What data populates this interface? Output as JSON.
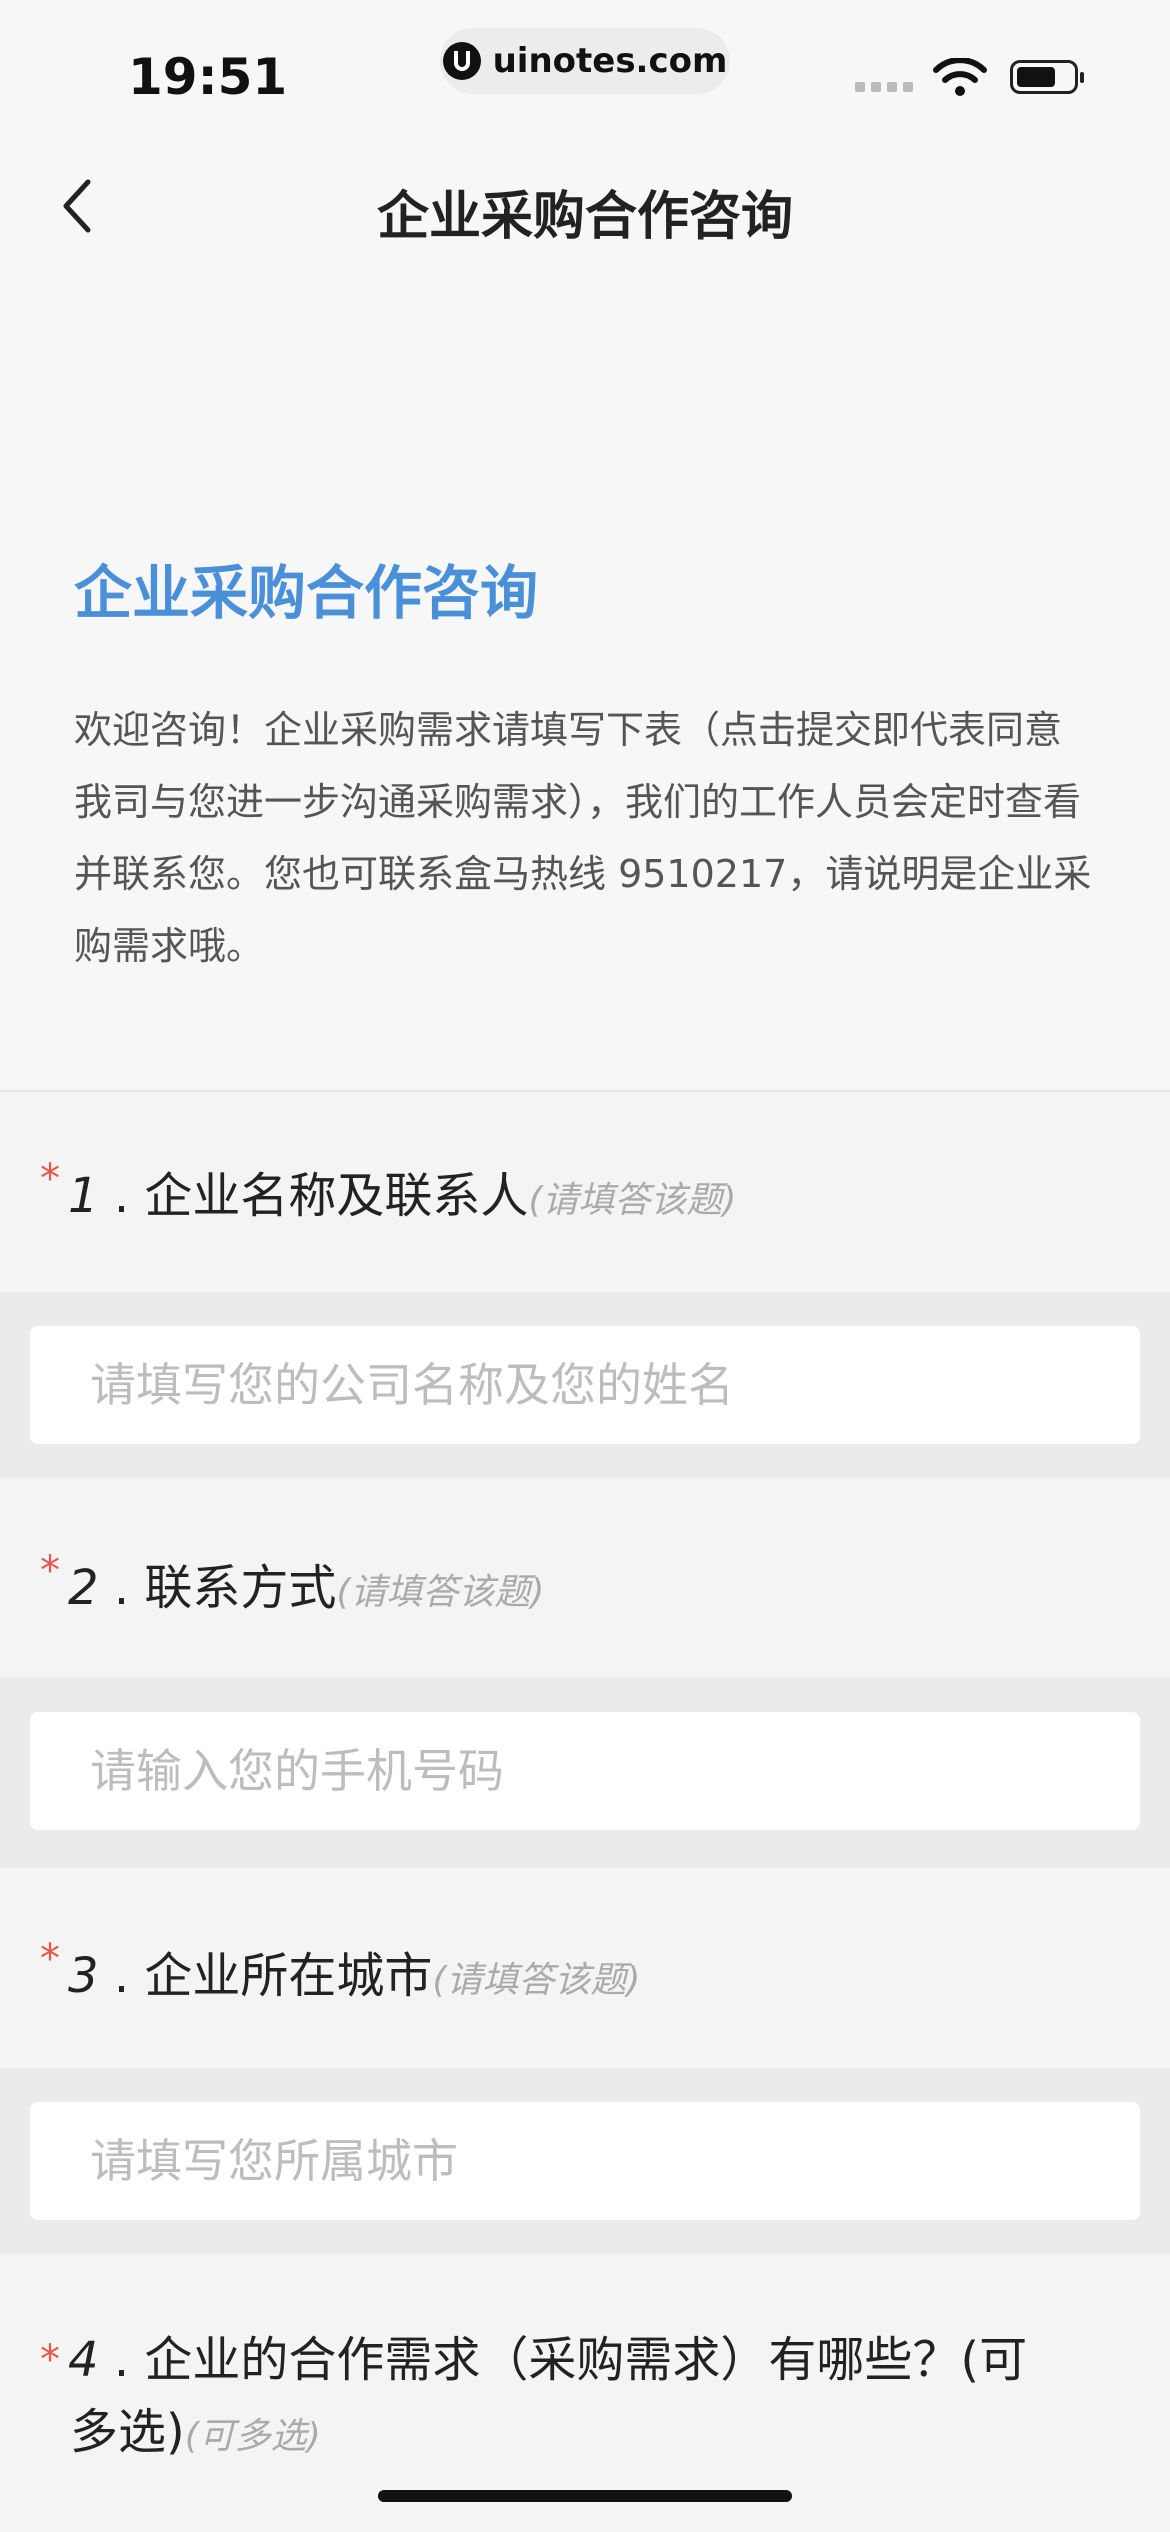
{
  "status_bar": {
    "time": "19:51",
    "url": "uinotes.com"
  },
  "nav": {
    "title": "企业采购合作咨询",
    "back_icon": "chevron-left-icon"
  },
  "intro": {
    "heading": "企业采购合作咨询",
    "text": "欢迎咨询！企业采购需求请填写下表（点击提交即代表同意我司与您进一步沟通采购需求），我们的工作人员会定时查看并联系您。您也可联系盒马热线 9510217，请说明是企业采购需求哦。"
  },
  "questions": [
    {
      "required": "*",
      "number": "1",
      "sep": ".",
      "label": "企业名称及联系人",
      "hint": "(请填答该题)",
      "placeholder": "请填写您的公司名称及您的姓名"
    },
    {
      "required": "*",
      "number": "2",
      "sep": ".",
      "label": "联系方式",
      "hint": "(请填答该题)",
      "placeholder": "请输入您的手机号码"
    },
    {
      "required": "*",
      "number": "3",
      "sep": ".",
      "label": "企业所在城市",
      "hint": "(请填答该题)",
      "placeholder": "请填写您所属城市"
    },
    {
      "required": "*",
      "number": "4",
      "sep": ".",
      "label": "企业的合作需求（采购需求）有哪些？(可",
      "label2": "多选)",
      "hint": "(可多选)"
    }
  ],
  "colors": {
    "accent": "#4a90d9",
    "required": "#e5574a"
  }
}
